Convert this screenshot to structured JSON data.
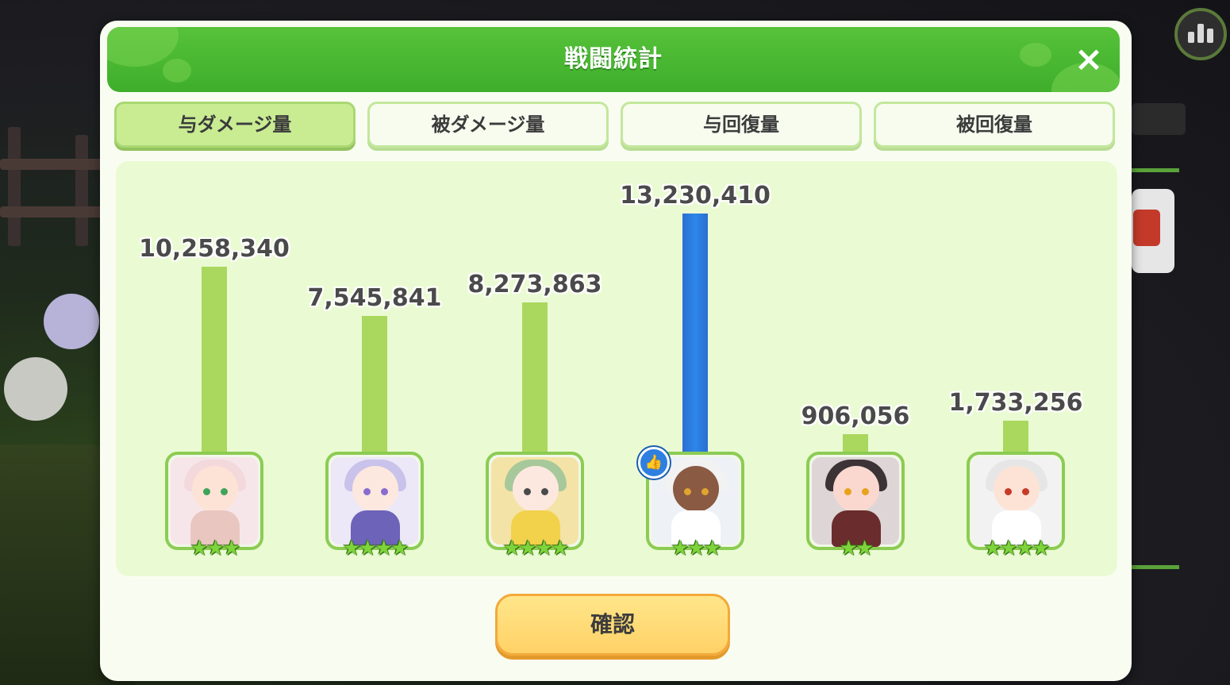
{
  "dialog": {
    "title": "戦闘統計",
    "close_icon": "×"
  },
  "tabs": [
    {
      "label": "与ダメージ量",
      "active": true
    },
    {
      "label": "被ダメージ量",
      "active": false
    },
    {
      "label": "与回復量",
      "active": false
    },
    {
      "label": "被回復量",
      "active": false
    }
  ],
  "characters": [
    {
      "value_label": "10,258,340",
      "value": 10258340,
      "stars": "★★★",
      "mvp": false
    },
    {
      "value_label": "7,545,841",
      "value": 7545841,
      "stars": "★★★★",
      "mvp": false
    },
    {
      "value_label": "8,273,863",
      "value": 8273863,
      "stars": "★★★★",
      "mvp": false
    },
    {
      "value_label": "13,230,410",
      "value": 13230410,
      "stars": "★★★",
      "mvp": true
    },
    {
      "value_label": "906,056",
      "value": 906056,
      "stars": "★★",
      "mvp": false
    },
    {
      "value_label": "1,733,256",
      "value": 1733256,
      "stars": "★★★★",
      "mvp": false
    }
  ],
  "mvp_badge_icon": "👍",
  "confirm_label": "確認",
  "colors": {
    "header_green": "#45b42e",
    "bar_green": "#aad75e",
    "bar_mvp_blue": "#2e86ea",
    "confirm_yellow": "#ffd166"
  }
}
